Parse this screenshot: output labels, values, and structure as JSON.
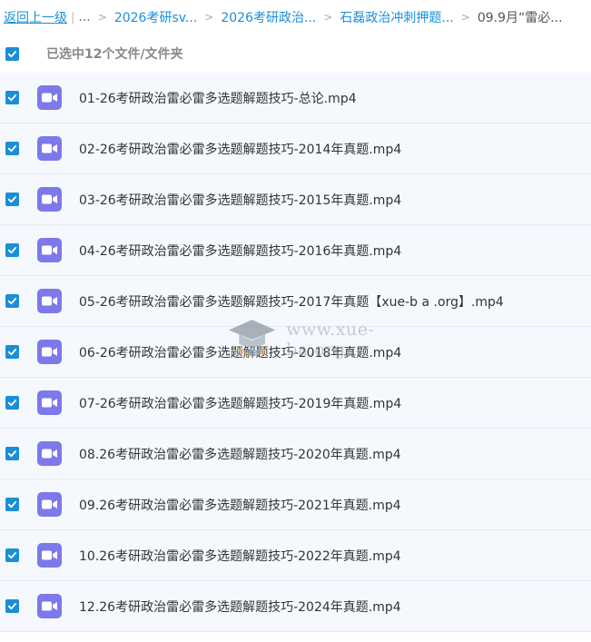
{
  "breadcrumb": {
    "back_label": "返回上一级",
    "separator": "|",
    "ellipsis": "...",
    "arrow": ">",
    "crumbs": [
      "2026考研sv...",
      "2026考研政治...",
      "石磊政治冲刺押题...",
      "09.9月“雷必..."
    ]
  },
  "selection": {
    "label": "已选中12个文件/文件夹"
  },
  "files": [
    {
      "name": "01-26考研政治雷必雷多选题解题技巧-总论.mp4"
    },
    {
      "name": "02-26考研政治雷必雷多选题解题技巧-2014年真题.mp4"
    },
    {
      "name": "03-26考研政治雷必雷多选题解题技巧-2015年真题.mp4"
    },
    {
      "name": "04-26考研政治雷必雷多选题解题技巧-2016年真题.mp4"
    },
    {
      "name": "05-26考研政治雷必雷多选题解题技巧-2017年真题【xue-b a .org】.mp4"
    },
    {
      "name": "06-26考研政治雷必雷多选题解题技巧-2018年真题.mp4"
    },
    {
      "name": "07-26考研政治雷必雷多选题解题技巧-2019年真题.mp4"
    },
    {
      "name": "08.26考研政治雷必雷多选题解题技巧-2020年真题.mp4"
    },
    {
      "name": "09.26考研政治雷必雷多选题解题技巧-2021年真题.mp4"
    },
    {
      "name": "10.26考研政治雷必雷多选题解题技巧-2022年真题.mp4"
    },
    {
      "name": "12.26考研政治雷必雷多选题解题技巧-2024年真题.mp4"
    }
  ],
  "watermark": {
    "text": "www.xue-ba.org",
    "icon": "graduation-cap-icon"
  },
  "colors": {
    "accent": "#1a8fd8",
    "file_icon": "#7c79ea",
    "row_bg": "#f5f9fd"
  }
}
